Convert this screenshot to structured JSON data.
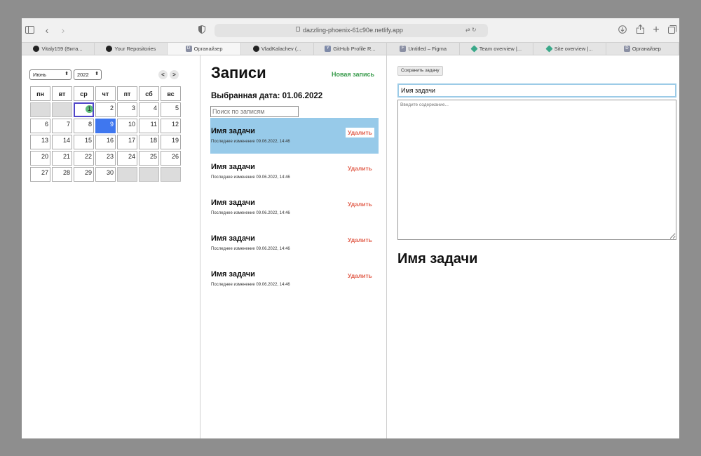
{
  "browser": {
    "url": "dazzling-phoenix-61c90e.netlify.app",
    "tabs": [
      {
        "label": "Vitaly159 (Вита...",
        "icon": "github-icon",
        "color": "#222222"
      },
      {
        "label": "Your Repositories",
        "icon": "github-icon",
        "color": "#222222"
      },
      {
        "label": "Органайзер",
        "icon": "d-favicon-icon",
        "color": "#8a8fa3",
        "letter": "D",
        "active": true
      },
      {
        "label": "VladKalachev (...",
        "icon": "github-icon",
        "color": "#222222"
      },
      {
        "label": "GitHub Profile R...",
        "icon": "y-favicon-icon",
        "color": "#7e8aa8",
        "letter": "Y"
      },
      {
        "label": "Untitled – Figma",
        "icon": "f-favicon-icon",
        "color": "#8a8fa3",
        "letter": "F"
      },
      {
        "label": "Team overview |...",
        "icon": "diamond-icon",
        "color": "#3aa889"
      },
      {
        "label": "Site overview |...",
        "icon": "diamond-icon",
        "color": "#3aa889"
      },
      {
        "label": "Органайзер",
        "icon": "d-favicon-icon",
        "color": "#8a8fa3",
        "letter": "D"
      }
    ]
  },
  "calendar": {
    "month": "Июнь",
    "year": "2022",
    "prev": "<",
    "next": ">",
    "weekdays": [
      "пн",
      "вт",
      "ср",
      "чт",
      "пт",
      "сб",
      "вс"
    ],
    "weeks": [
      [
        "",
        "",
        "1",
        "2",
        "3",
        "4",
        "5"
      ],
      [
        "6",
        "7",
        "8",
        "9",
        "10",
        "11",
        "12"
      ],
      [
        "13",
        "14",
        "15",
        "16",
        "17",
        "18",
        "19"
      ],
      [
        "20",
        "21",
        "22",
        "23",
        "24",
        "25",
        "26"
      ],
      [
        "27",
        "28",
        "29",
        "30",
        "",
        "",
        ""
      ]
    ],
    "today": "1",
    "selected": "9",
    "accent": "#3f77ef"
  },
  "notes": {
    "title": "Записи",
    "new_note": "Новая запись",
    "selected_date": "Выбранная дата: 01.06.2022",
    "search_placeholder": "Поиск по записям",
    "delete_label": "Удалить",
    "items": [
      {
        "title": "Имя задачи",
        "modified": "Последнее изменение 09.06.2022, 14:46",
        "active": true
      },
      {
        "title": "Имя задачи",
        "modified": "Последнее изменение 09.06.2022, 14:46"
      },
      {
        "title": "Имя задачи",
        "modified": "Последнее изменение 09.06.2022, 14:46"
      },
      {
        "title": "Имя задачи",
        "modified": "Последнее изменение 09.06.2022, 14:46"
      },
      {
        "title": "Имя задачи",
        "modified": "Последнее изменение 09.06.2022, 14:46"
      }
    ]
  },
  "editor": {
    "save_label": "Сохранить задачу",
    "title_value": "Имя задачи",
    "content_placeholder": "Введите содержание...",
    "preview_title": "Имя задачи"
  }
}
